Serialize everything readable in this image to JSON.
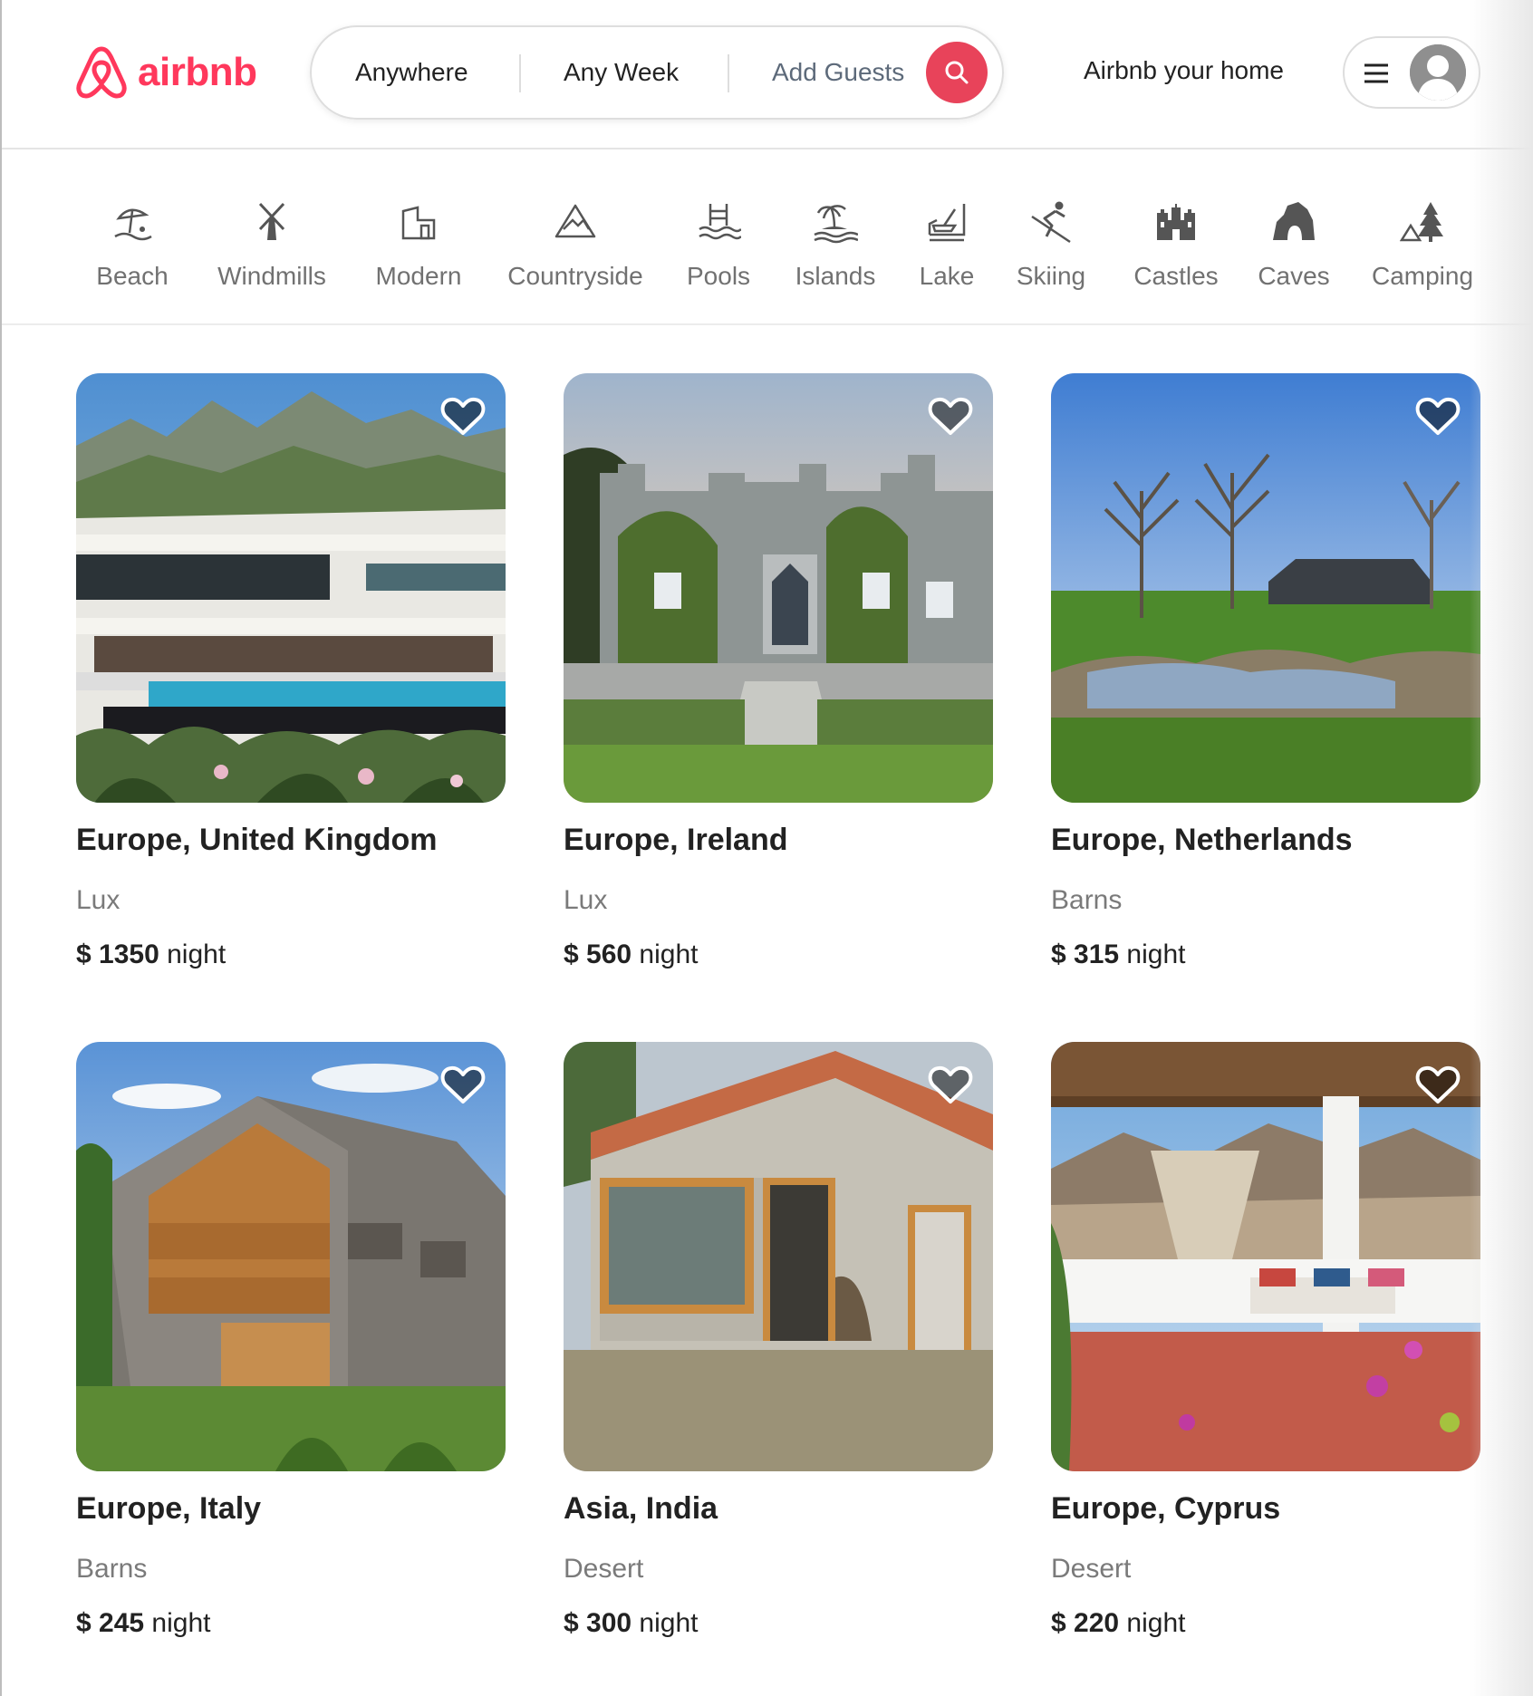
{
  "brand": {
    "name": "airbnb",
    "color": "#ff385c"
  },
  "search": {
    "anywhere": "Anywhere",
    "any_week": "Any Week",
    "add_guests": "Add Guests",
    "button_icon": "search-icon"
  },
  "header": {
    "host_link": "Airbnb your home"
  },
  "categories": [
    {
      "label": "Beach",
      "icon": "beach-icon"
    },
    {
      "label": "Windmills",
      "icon": "windmill-icon"
    },
    {
      "label": "Modern",
      "icon": "modern-house-icon"
    },
    {
      "label": "Countryside",
      "icon": "mountain-icon"
    },
    {
      "label": "Pools",
      "icon": "pool-icon"
    },
    {
      "label": "Islands",
      "icon": "island-icon"
    },
    {
      "label": "Lake",
      "icon": "lake-icon"
    },
    {
      "label": "Skiing",
      "icon": "skiing-icon"
    },
    {
      "label": "Castles",
      "icon": "castle-icon"
    },
    {
      "label": "Caves",
      "icon": "cave-icon"
    },
    {
      "label": "Camping",
      "icon": "camping-icon"
    }
  ],
  "listings": [
    {
      "location": "Europe, United Kingdom",
      "type": "Lux",
      "price": "$ 1350",
      "unit": "night"
    },
    {
      "location": "Europe, Ireland",
      "type": "Lux",
      "price": "$ 560",
      "unit": "night"
    },
    {
      "location": "Europe, Netherlands",
      "type": "Barns",
      "price": "$ 315",
      "unit": "night"
    },
    {
      "location": "Europe, Italy",
      "type": "Barns",
      "price": "$ 245",
      "unit": "night"
    },
    {
      "location": "Asia, India",
      "type": "Desert",
      "price": "$ 300",
      "unit": "night"
    },
    {
      "location": "Europe, Cyprus",
      "type": "Desert",
      "price": "$ 220",
      "unit": "night"
    }
  ]
}
